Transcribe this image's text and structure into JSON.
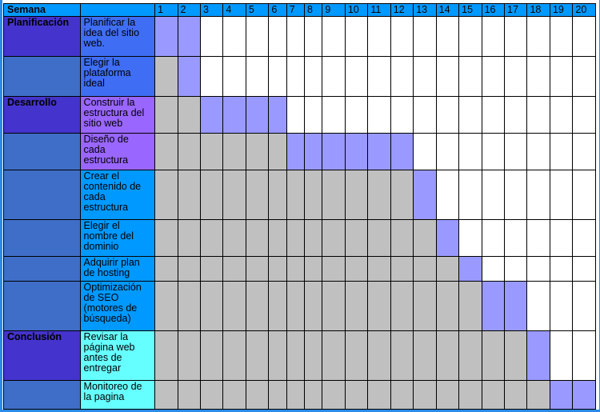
{
  "header": {
    "week_label": "Semana",
    "weeks": [
      "1",
      "2",
      "3",
      "4",
      "5",
      "6",
      "7",
      "8",
      "9",
      "10",
      "11",
      "12",
      "13",
      "14",
      "15",
      "16",
      "17",
      "18",
      "19",
      "20"
    ]
  },
  "colors": {
    "header_bg": "#0099ff",
    "planning_phase": "#4433cc",
    "development_phase": "#4433cc",
    "conclusion_phase": "#4433cc",
    "empty_phase": "#3f6ec8",
    "active_week": "#9999ff",
    "past_week": "#c0c0c0",
    "future_week": "#ffffff"
  },
  "rows": [
    {
      "phase": "Planificación",
      "phase_color": "#4433cc",
      "task": "Planificar la idea del sitio web.",
      "task_color": "#3f6ef5",
      "cells": "AAEEEEEEEEEEEEEEEEEE"
    },
    {
      "phase": "",
      "phase_color": "#3f6ec8",
      "task": "Elegir la plataforma ideal",
      "task_color": "#3f6ef5",
      "cells": "GAEEEEEEEEEEEEEEEEEE"
    },
    {
      "phase": "Desarrollo",
      "phase_color": "#4433cc",
      "task": "Construir la estructura del sitio web",
      "task_color": "#9966ff",
      "cells": "GGAAAAEEEEEEEEEEEEEE"
    },
    {
      "phase": "",
      "phase_color": "#3f6ec8",
      "task": "Diseño de cada estructura",
      "task_color": "#9966ff",
      "cells": "GGGGGGAAAAAAEEEEEEEE"
    },
    {
      "phase": "",
      "phase_color": "#3f6ec8",
      "task": "Crear el contenido de cada estructura",
      "task_color": "#0099ff",
      "cells": "GGGGGGGGGGGGAEEEEEEE"
    },
    {
      "phase": "",
      "phase_color": "#3f6ec8",
      "task": "Elegir el nombre del dominio",
      "task_color": "#0099ff",
      "cells": "GGGGGGGGGGGGGAEEEEEE"
    },
    {
      "phase": "",
      "phase_color": "#3f6ec8",
      "task": "Adquirir plan de hosting",
      "task_color": "#0099ff",
      "cells": "GGGGGGGGGGGGGGAEEEEE"
    },
    {
      "phase": "",
      "phase_color": "#3f6ec8",
      "task": "Optimización de SEO (motores de búsqueda)",
      "task_color": "#0099ff",
      "cells": "GGGGGGGGGGGGGGGAAEEE"
    },
    {
      "phase": "Conclusión",
      "phase_color": "#4433cc",
      "task": "Revisar la página web antes de entregar",
      "task_color": "#66ffff",
      "cells": "GGGGGGGGGGGGGGGGGAEE"
    },
    {
      "phase": "",
      "phase_color": "#3f6ec8",
      "task": "Monitoreo de la pagina",
      "task_color": "#66ffff",
      "cells": "GGGGGGGGGGGGGGGGGGAA"
    }
  ]
}
